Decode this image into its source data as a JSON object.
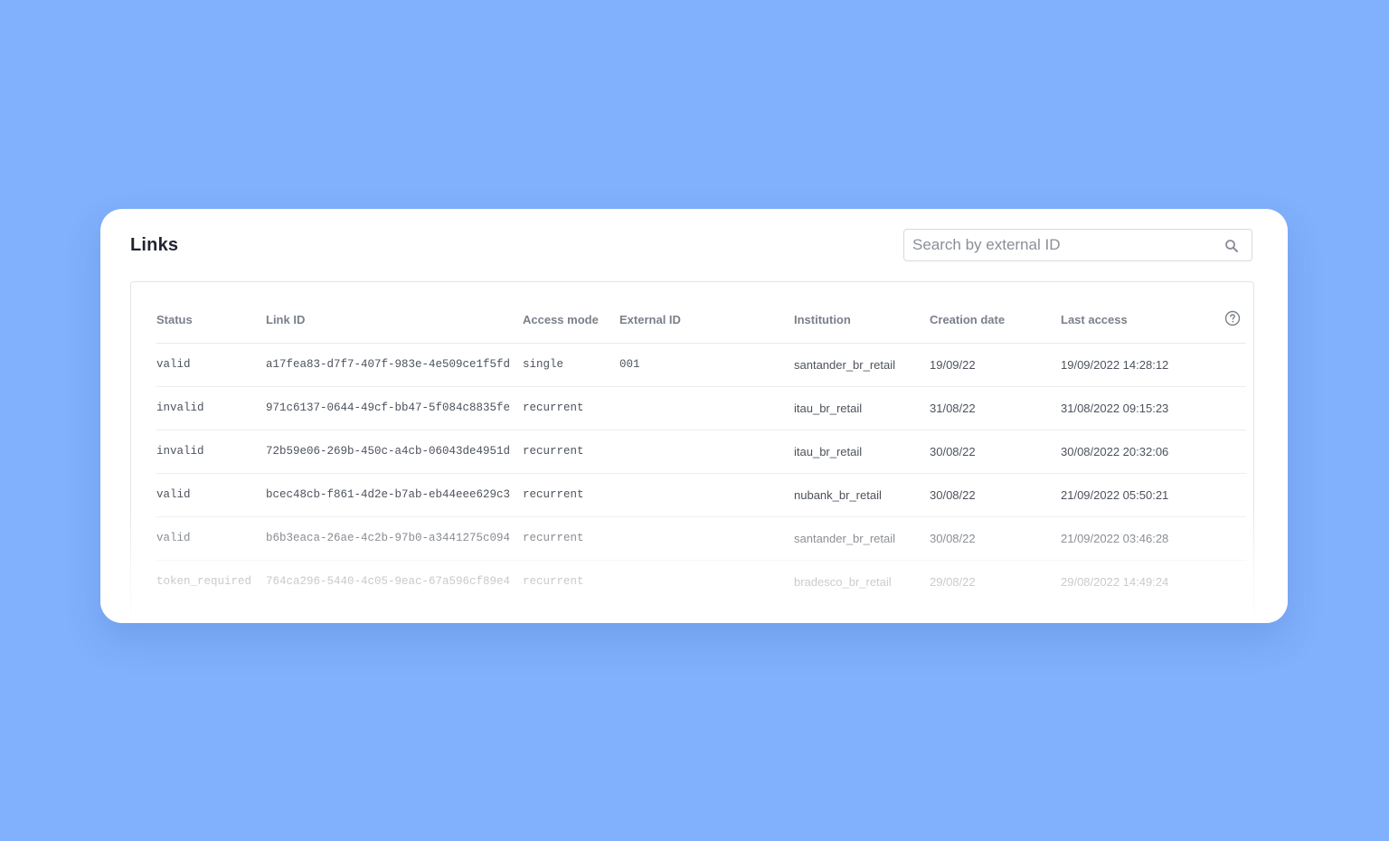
{
  "page": {
    "title": "Links"
  },
  "search": {
    "placeholder": "Search by external ID",
    "icon": "search-icon"
  },
  "table": {
    "columns": [
      "Status",
      "Link ID",
      "Access mode",
      "External ID",
      "Institution",
      "Creation date",
      "Last access"
    ],
    "help_icon": "question-circle-icon",
    "rows": [
      {
        "status": "valid",
        "link_id": "a17fea83-d7f7-407f-983e-4e509ce1f5fd",
        "access_mode": "single",
        "external_id": "001",
        "institution": "santander_br_retail",
        "creation_date": "19/09/22",
        "last_access": "19/09/2022 14:28:12"
      },
      {
        "status": "invalid",
        "link_id": "971c6137-0644-49cf-bb47-5f084c8835fe",
        "access_mode": "recurrent",
        "external_id": "",
        "institution": "itau_br_retail",
        "creation_date": "31/08/22",
        "last_access": "31/08/2022 09:15:23"
      },
      {
        "status": "invalid",
        "link_id": "72b59e06-269b-450c-a4cb-06043de4951d",
        "access_mode": "recurrent",
        "external_id": "",
        "institution": "itau_br_retail",
        "creation_date": "30/08/22",
        "last_access": "30/08/2022 20:32:06"
      },
      {
        "status": "valid",
        "link_id": "bcec48cb-f861-4d2e-b7ab-eb44eee629c3",
        "access_mode": "recurrent",
        "external_id": "",
        "institution": "nubank_br_retail",
        "creation_date": "30/08/22",
        "last_access": "21/09/2022 05:50:21"
      },
      {
        "status": "valid",
        "link_id": "b6b3eaca-26ae-4c2b-97b0-a3441275c094",
        "access_mode": "recurrent",
        "external_id": "",
        "institution": "santander_br_retail",
        "creation_date": "30/08/22",
        "last_access": "21/09/2022 03:46:28"
      },
      {
        "status": "token_required",
        "link_id": "764ca296-5440-4c05-9eac-67a596cf89e4",
        "access_mode": "recurrent",
        "external_id": "",
        "institution": "bradesco_br_retail",
        "creation_date": "29/08/22",
        "last_access": "29/08/2022 14:49:24"
      }
    ]
  },
  "colors": {
    "background": "#81b0fc",
    "card": "#ffffff",
    "header_text": "#7a808a",
    "cell_text": "#4d535c"
  }
}
